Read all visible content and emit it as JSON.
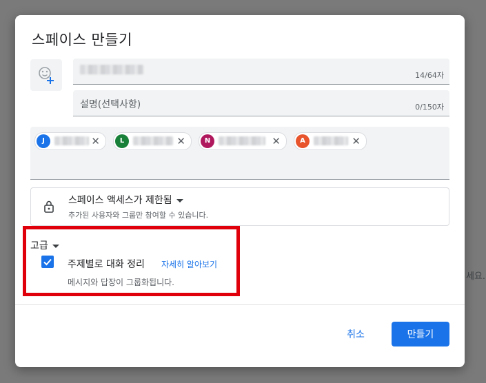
{
  "backdrop": {
    "partial_text": "세요."
  },
  "dialog": {
    "title": "스페이스 만들기",
    "name_field": {
      "counter": "14/64자"
    },
    "description_field": {
      "placeholder": "설명(선택사항)",
      "counter": "0/150자"
    },
    "people": [
      {
        "initial": "J",
        "color": "#1a73e8"
      },
      {
        "initial": "L",
        "color": "#188038"
      },
      {
        "initial": "N",
        "color": "#b0185e"
      },
      {
        "initial": "A",
        "color": "#e8542c"
      }
    ],
    "access": {
      "title": "스페이스 액세스가 제한됨",
      "subtitle": "추가된 사용자와 그룹만 참여할 수 있습니다."
    },
    "advanced": {
      "label": "고급",
      "topic_threading": {
        "label": "주제별로 대화 정리",
        "link": "자세히 알아보기",
        "description": "메시지와 답장이 그룹화됩니다.",
        "checked": true
      }
    },
    "buttons": {
      "cancel": "취소",
      "create": "만들기"
    }
  }
}
